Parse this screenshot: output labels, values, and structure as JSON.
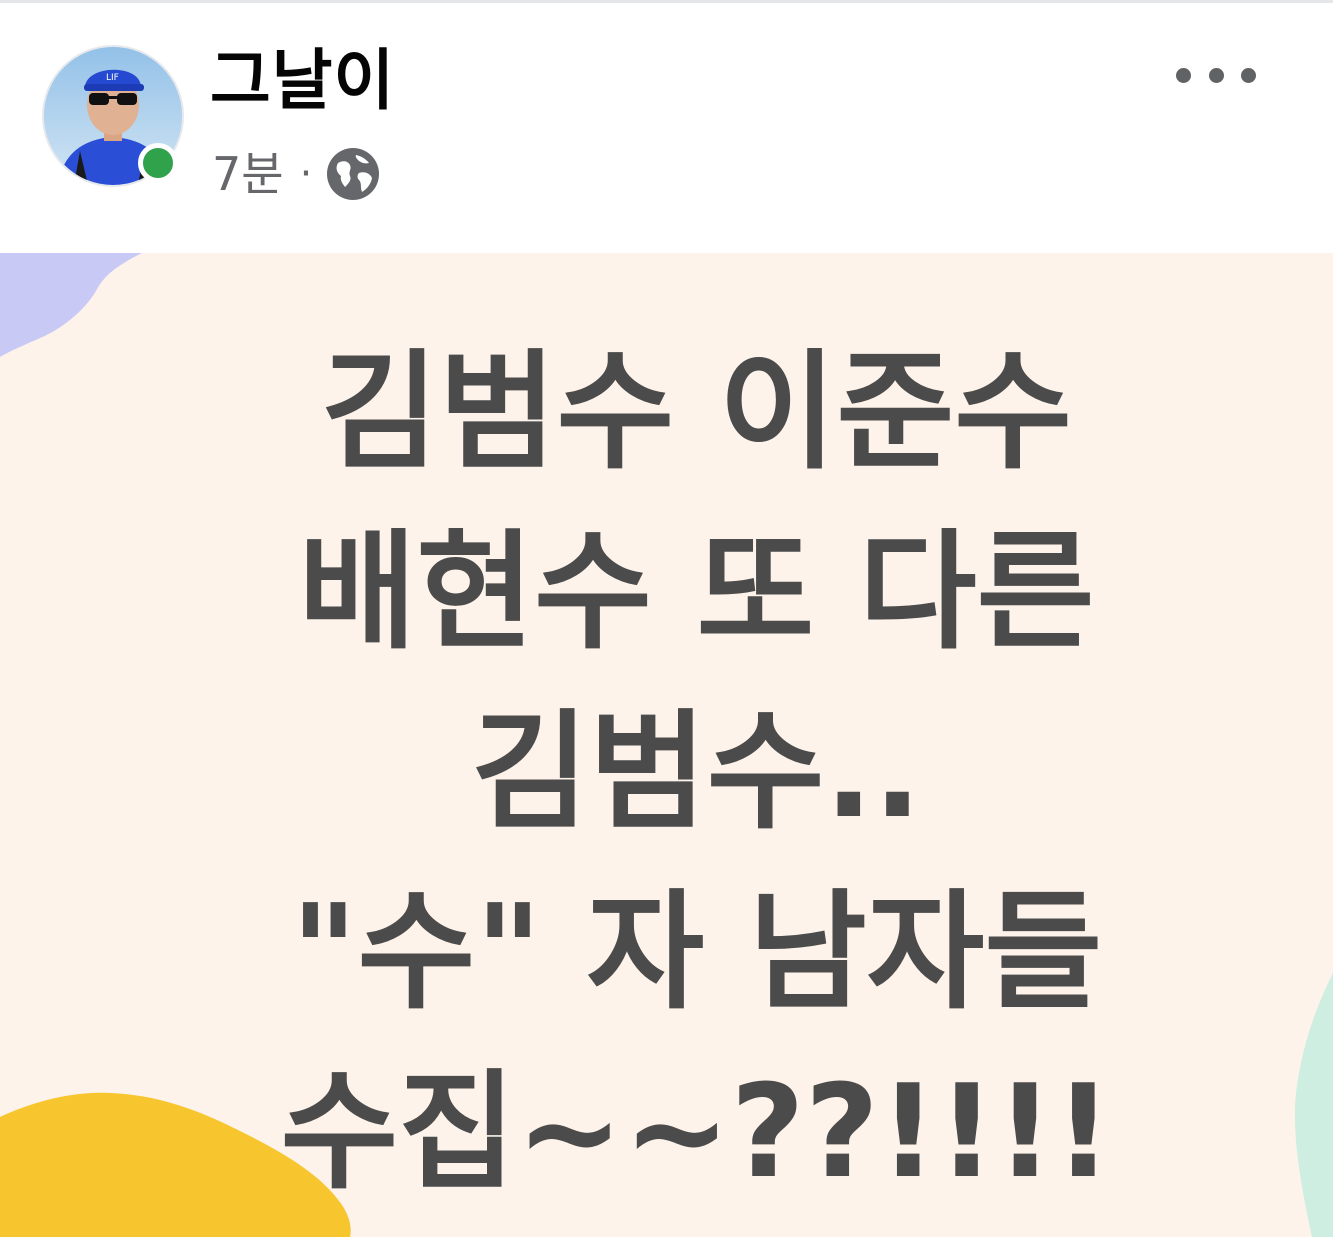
{
  "post": {
    "author": "그날이",
    "timestamp": "7분",
    "separator": "·",
    "privacy_icon": "globe-icon",
    "more_icon": "more-horizontal-icon",
    "online_status_color": "#31a24c"
  },
  "background_post": {
    "lines": [
      "김범수 이준수",
      "배현수 또 다른",
      "김범수..",
      "\"수\" 자 남자들",
      "수집~~??!!!!"
    ],
    "background_color": "#fdf3ea",
    "text_color": "#4b4b4b",
    "decor_colors": [
      "#c9c9f5",
      "#f7c52e",
      "#cdeee0"
    ]
  }
}
